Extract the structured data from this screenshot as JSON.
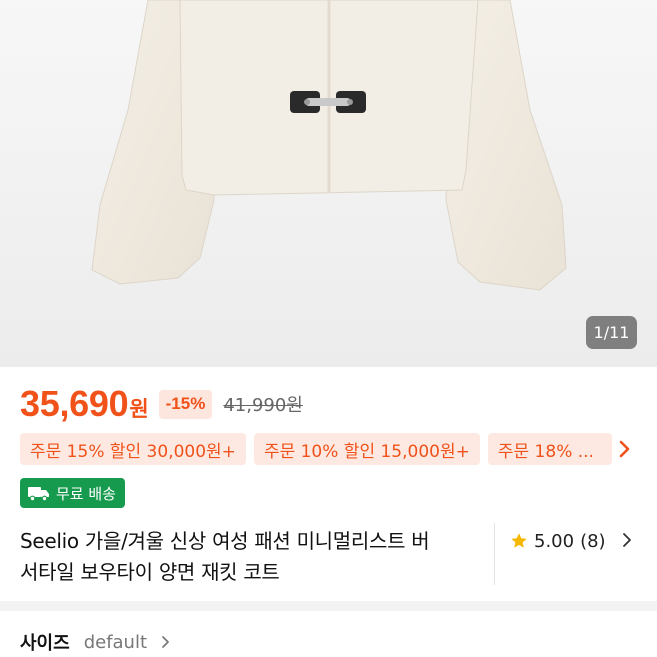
{
  "gallery": {
    "counter": "1/11"
  },
  "price": {
    "amount": "35,690",
    "currency": "원",
    "discount": "-15%",
    "original": "41,990원"
  },
  "coupons": [
    {
      "label": "주문 15% 할인 30,000원+"
    },
    {
      "label": "주문 10% 할인 15,000원+"
    },
    {
      "label": "주문 18% ..."
    }
  ],
  "shipping_badge": {
    "label": "무료 배송"
  },
  "product": {
    "title_line1": "Seelio 가을/겨울 신상 여성 패션 미니멀리스트 버",
    "title_line2": "서타일 보우타이 양면 재킷 코트"
  },
  "rating": {
    "score": "5.00",
    "count": "(8)"
  },
  "options": {
    "size_label": "사이즈",
    "size_value": "default"
  },
  "colors": {
    "accent": "#f0521a",
    "badge_green": "#169b4e",
    "star": "#f5b800"
  },
  "icons": [
    "truck-icon",
    "star-icon",
    "chevron-right-icon"
  ]
}
